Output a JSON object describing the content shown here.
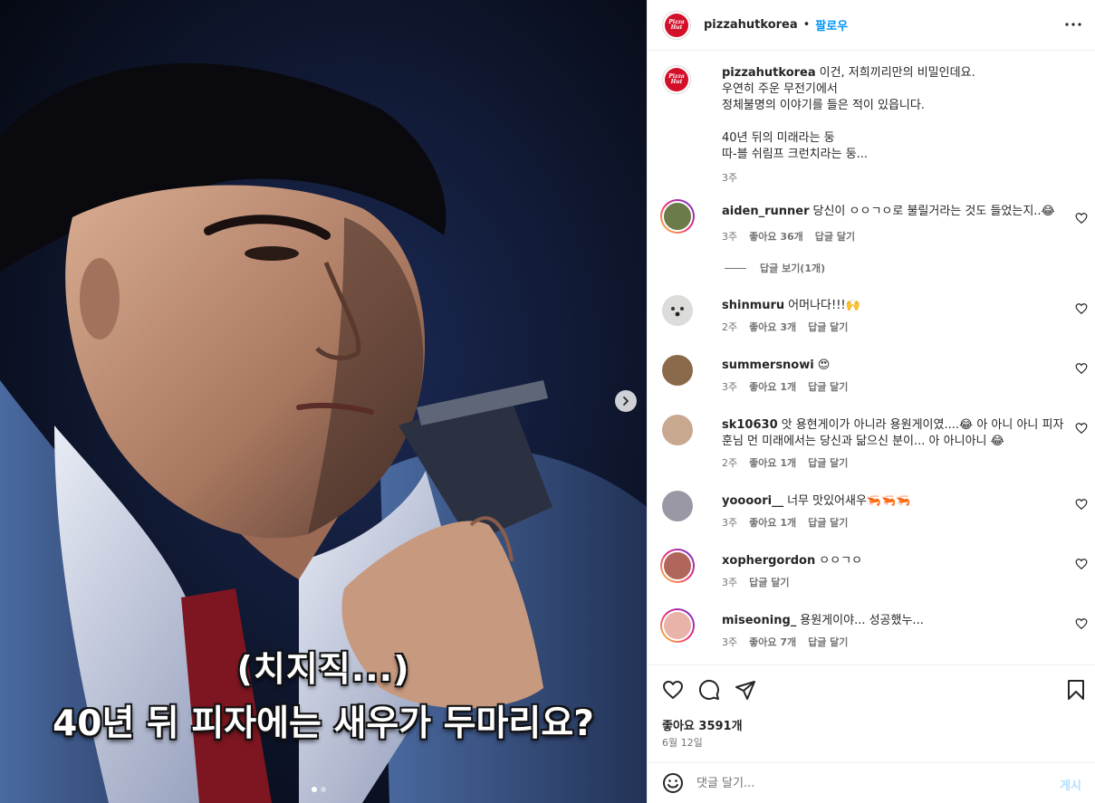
{
  "post": {
    "author": "pizzahutkorea",
    "follow_label": "팔로우",
    "separator": "•",
    "logo_text_line1": "Pizza",
    "logo_text_line2": "Hut",
    "caption_lines": [
      "이건, 저희끼리만의 비밀인데요.",
      "우연히 주운 무전기에서",
      "정체불명의 이야기를 들은 적이 있읍니다.",
      "",
      "40년 뒤의 미래라는 둥",
      "따-블 쉬림프 크런치라는 둥..."
    ],
    "caption_age": "3주"
  },
  "media": {
    "overlay_line1": "(치지직...)",
    "overlay_line2": "40년 뒤 피자에는 새우가 두마리요?",
    "slide_count": 2,
    "active_slide": 1
  },
  "comments": [
    {
      "user": "aiden_runner",
      "text": "당신이 ㅇㅇㄱㅇ로 불릴거라는 것도 들었는지..😂",
      "age": "3주",
      "likes": "좋아요 36개",
      "reply": "답글 달기",
      "view_replies": "답글 보기(1개)",
      "avatar_color": "#6b7b4a",
      "story": true
    },
    {
      "user": "shinmuru",
      "text": "어머나다!!!🙌",
      "age": "2주",
      "likes": "좋아요 3개",
      "reply": "답글 달기",
      "avatar_color": "#d9d9d6",
      "story": false
    },
    {
      "user": "summersnowi",
      "text": "😍",
      "age": "3주",
      "likes": "좋아요 1개",
      "reply": "답글 달기",
      "avatar_color": "#8a6a4a",
      "story": false
    },
    {
      "user": "sk10630",
      "text_line1": "앗 용현게이가 아니라 용원게이였....😂 아 아니 아니 피자",
      "text_line2": "훈님 먼 미래에서는 당신과 닮으신 분이... 아 아니아니 😂",
      "age": "2주",
      "likes": "좋아요 1개",
      "reply": "답글 달기",
      "avatar_color": "#c9a890",
      "story": false
    },
    {
      "user": "yoooori__",
      "text": "너무 맛있어새우🦐🦐🦐",
      "age": "3주",
      "likes": "좋아요 1개",
      "reply": "답글 달기",
      "avatar_color": "#9b98a6",
      "story": false
    },
    {
      "user": "xophergordon",
      "text": "ㅇㅇㄱㅇ",
      "age": "3주",
      "reply": "답글 달기",
      "avatar_color": "#b0665a",
      "story": true
    },
    {
      "user": "miseoning_",
      "text": "용원게이야... 성공했누...",
      "age": "3주",
      "likes": "좋아요 7개",
      "reply": "답글 달기",
      "avatar_color": "#e8b3a8",
      "story": true
    }
  ],
  "footer": {
    "likes": "좋아요 3591개",
    "date": "6월 12일",
    "input_placeholder": "댓글 달기...",
    "post_label": "게시"
  },
  "colors": {
    "accent": "#0095f6",
    "brand_red": "#d3102a",
    "muted": "#737373",
    "border": "#efefef"
  },
  "icons": [
    "more-options-icon",
    "heart-icon",
    "comment-icon",
    "share-icon",
    "save-icon",
    "emoji-icon",
    "chevron-right-icon"
  ]
}
